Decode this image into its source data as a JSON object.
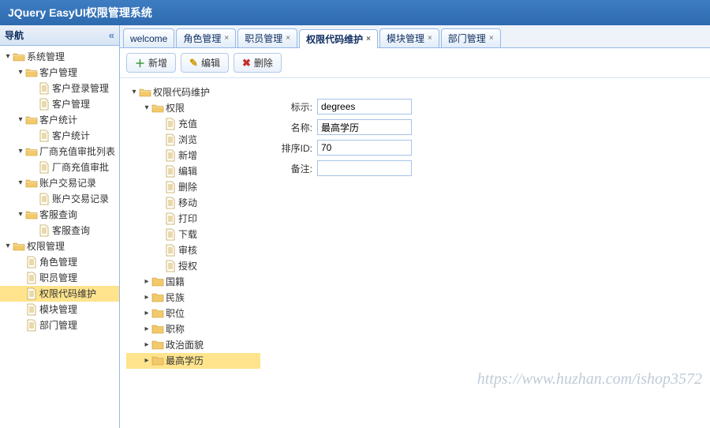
{
  "app": {
    "title": "JQuery EasyUI权限管理系统"
  },
  "sidebar": {
    "title": "导航",
    "tree": [
      {
        "label": "系统管理",
        "type": "folder",
        "depth": 0,
        "expanded": true,
        "selected": false
      },
      {
        "label": "客户管理",
        "type": "folder",
        "depth": 1,
        "expanded": true,
        "selected": false
      },
      {
        "label": "客户登录管理",
        "type": "file",
        "depth": 2,
        "selected": false
      },
      {
        "label": "客户管理",
        "type": "file",
        "depth": 2,
        "selected": false
      },
      {
        "label": "客户统计",
        "type": "folder",
        "depth": 1,
        "expanded": true,
        "selected": false
      },
      {
        "label": "客户统计",
        "type": "file",
        "depth": 2,
        "selected": false
      },
      {
        "label": "厂商充值审批列表",
        "type": "folder",
        "depth": 1,
        "expanded": true,
        "selected": false
      },
      {
        "label": "厂商充值审批",
        "type": "file",
        "depth": 2,
        "selected": false
      },
      {
        "label": "账户交易记录",
        "type": "folder",
        "depth": 1,
        "expanded": true,
        "selected": false
      },
      {
        "label": "账户交易记录",
        "type": "file",
        "depth": 2,
        "selected": false
      },
      {
        "label": "客服查询",
        "type": "folder",
        "depth": 1,
        "expanded": true,
        "selected": false
      },
      {
        "label": "客服查询",
        "type": "file",
        "depth": 2,
        "selected": false
      },
      {
        "label": "权限管理",
        "type": "folder",
        "depth": 0,
        "expanded": true,
        "selected": false
      },
      {
        "label": "角色管理",
        "type": "file",
        "depth": 1,
        "selected": false
      },
      {
        "label": "职员管理",
        "type": "file",
        "depth": 1,
        "selected": false
      },
      {
        "label": "权限代码维护",
        "type": "file",
        "depth": 1,
        "selected": true
      },
      {
        "label": "模块管理",
        "type": "file",
        "depth": 1,
        "selected": false
      },
      {
        "label": "部门管理",
        "type": "file",
        "depth": 1,
        "selected": false
      }
    ]
  },
  "tabs": [
    {
      "label": "welcome",
      "closable": false,
      "active": false
    },
    {
      "label": "角色管理",
      "closable": true,
      "active": false
    },
    {
      "label": "职员管理",
      "closable": true,
      "active": false
    },
    {
      "label": "权限代码维护",
      "closable": true,
      "active": true
    },
    {
      "label": "模块管理",
      "closable": true,
      "active": false
    },
    {
      "label": "部门管理",
      "closable": true,
      "active": false
    }
  ],
  "toolbar": {
    "add": "新增",
    "edit": "编辑",
    "del": "删除"
  },
  "center_tree": [
    {
      "label": "权限代码维护",
      "type": "folder",
      "depth": 0,
      "expanded": true,
      "selected": false
    },
    {
      "label": "权限",
      "type": "folder",
      "depth": 1,
      "expanded": true,
      "selected": false
    },
    {
      "label": "充值",
      "type": "file",
      "depth": 2,
      "selected": false
    },
    {
      "label": "浏览",
      "type": "file",
      "depth": 2,
      "selected": false
    },
    {
      "label": "新增",
      "type": "file",
      "depth": 2,
      "selected": false
    },
    {
      "label": "编辑",
      "type": "file",
      "depth": 2,
      "selected": false
    },
    {
      "label": "删除",
      "type": "file",
      "depth": 2,
      "selected": false
    },
    {
      "label": "移动",
      "type": "file",
      "depth": 2,
      "selected": false
    },
    {
      "label": "打印",
      "type": "file",
      "depth": 2,
      "selected": false
    },
    {
      "label": "下载",
      "type": "file",
      "depth": 2,
      "selected": false
    },
    {
      "label": "审核",
      "type": "file",
      "depth": 2,
      "selected": false
    },
    {
      "label": "授权",
      "type": "file",
      "depth": 2,
      "selected": false
    },
    {
      "label": "国籍",
      "type": "folder",
      "depth": 1,
      "expanded": false,
      "selected": false
    },
    {
      "label": "民族",
      "type": "folder",
      "depth": 1,
      "expanded": false,
      "selected": false
    },
    {
      "label": "职位",
      "type": "folder",
      "depth": 1,
      "expanded": false,
      "selected": false
    },
    {
      "label": "职称",
      "type": "folder",
      "depth": 1,
      "expanded": false,
      "selected": false
    },
    {
      "label": "政治面貌",
      "type": "folder",
      "depth": 1,
      "expanded": false,
      "selected": false
    },
    {
      "label": "最高学历",
      "type": "folder",
      "depth": 1,
      "expanded": false,
      "selected": true
    }
  ],
  "form": {
    "fields": {
      "code_label": "标示:",
      "name_label": "名称:",
      "order_label": "排序ID:",
      "remark_label": "备注:"
    },
    "values": {
      "code": "degrees",
      "name": "最高学历",
      "order": "70",
      "remark": ""
    }
  },
  "watermark": "https://www.huzhan.com/ishop3572"
}
